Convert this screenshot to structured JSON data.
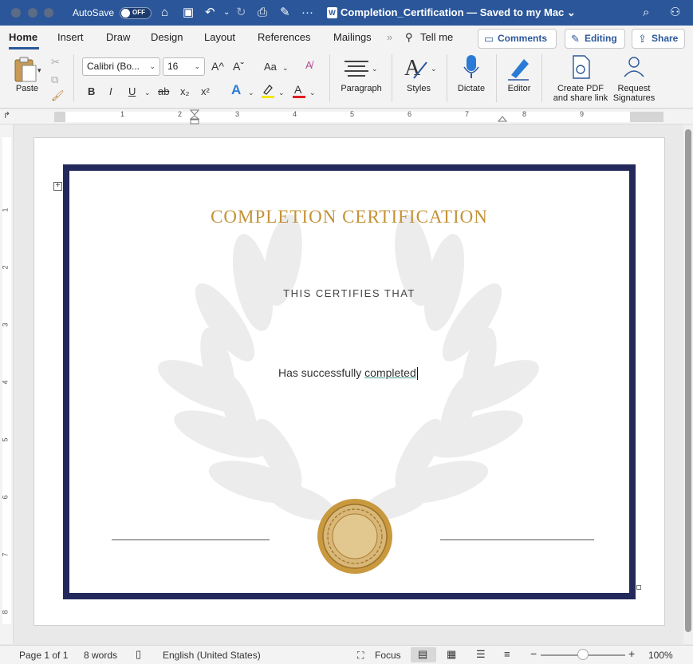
{
  "window": {
    "autosave_label": "AutoSave",
    "autosave_state": "OFF",
    "doc_title": "Completion_Certification — Saved to my Mac",
    "title_caret": "⌄"
  },
  "tabs": [
    {
      "label": "Home"
    },
    {
      "label": "Insert"
    },
    {
      "label": "Draw"
    },
    {
      "label": "Design"
    },
    {
      "label": "Layout"
    },
    {
      "label": "References"
    },
    {
      "label": "Mailings"
    }
  ],
  "tell_me": "Tell me",
  "top_buttons": {
    "comments": "Comments",
    "editing": "Editing",
    "share": "Share"
  },
  "ribbon": {
    "paste": "Paste",
    "font_name": "Calibri (Bo...",
    "font_size": "16",
    "paragraph": "Paragraph",
    "styles": "Styles",
    "dictate": "Dictate",
    "editor": "Editor",
    "create_pdf_line1": "Create PDF",
    "create_pdf_line2": "and share link",
    "request_sig_line1": "Request",
    "request_sig_line2": "Signatures",
    "grow_font": "A^",
    "shrink_font": "Aˇ",
    "change_case": "Aa",
    "bold": "B",
    "italic": "I",
    "underline": "U",
    "strike": "ab",
    "subscript": "x₂",
    "superscript": "x²"
  },
  "ruler": {
    "h_numbers": [
      "1",
      "2",
      "3",
      "4",
      "5",
      "6",
      "7",
      "8",
      "9"
    ],
    "v_numbers": [
      "1",
      "2",
      "3",
      "4",
      "5",
      "6",
      "7",
      "8"
    ]
  },
  "document": {
    "title": "COMPLETION CERTIFICATION",
    "subtitle": "THIS CERTIFIES THAT",
    "body_prefix": "Has successfully ",
    "body_word": "completed"
  },
  "status": {
    "page": "Page 1 of 1",
    "words": "8 words",
    "language": "English (United States)",
    "focus": "Focus",
    "zoom": "100%",
    "zoom_fraction": 0.5
  },
  "colors": {
    "titlebar": "#2b579a",
    "frame": "#23295a",
    "gold": "#c49237",
    "seal": "#c9993f"
  }
}
